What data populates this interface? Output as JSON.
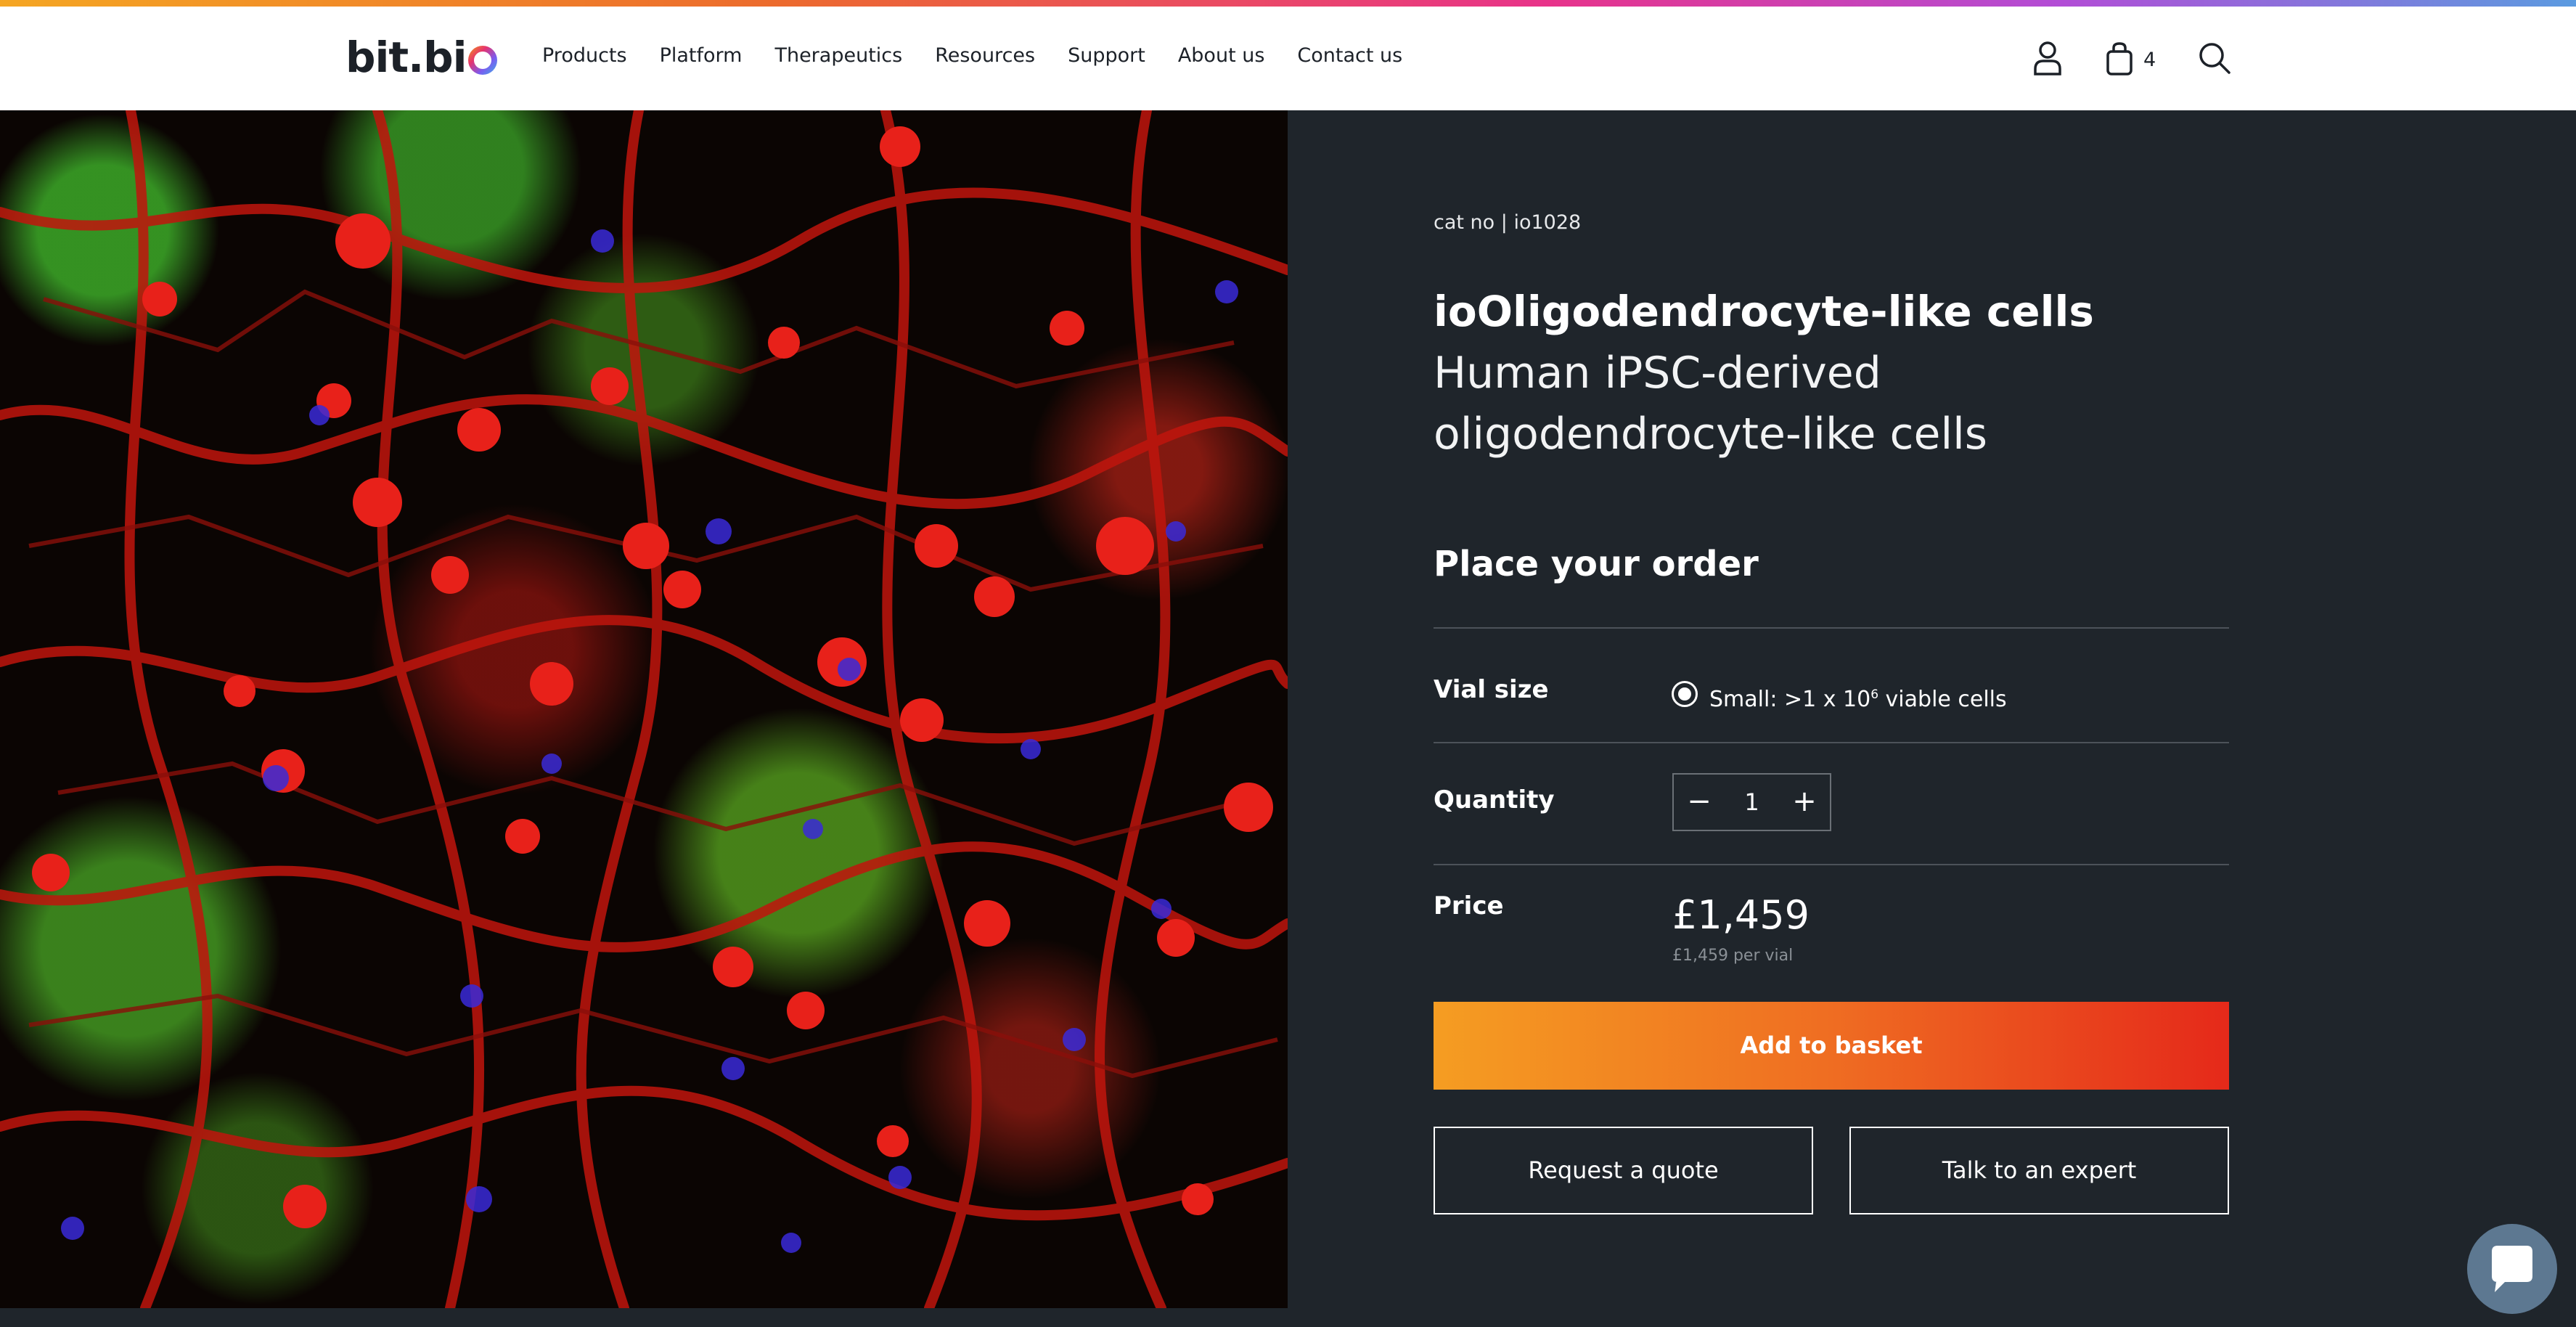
{
  "header": {
    "logo_text": "bit.bi",
    "nav": [
      "Products",
      "Platform",
      "Therapeutics",
      "Resources",
      "Support",
      "About us",
      "Contact us"
    ],
    "cart_count": "4"
  },
  "product": {
    "cat_no": "cat no | io1028",
    "title": "ioOligodendrocyte-like cells",
    "subtitle": "Human iPSC-derived oligodendrocyte-like cells"
  },
  "order": {
    "heading": "Place your order",
    "vial_label": "Vial size",
    "vial_option_pre": "Small: >1 x 10",
    "vial_option_sup": "6",
    "vial_option_post": " viable cells",
    "quantity_label": "Quantity",
    "quantity_value": "1",
    "minus": "−",
    "plus": "+",
    "price_label": "Price",
    "price": "£1,459",
    "price_per": "£1,459 per vial",
    "add_to_basket": "Add to basket",
    "request_quote": "Request a quote",
    "talk_expert": "Talk to an expert"
  },
  "colors": {
    "accent_orange": "#f59d22",
    "accent_red": "#e5291a",
    "background_dark": "#1f252b"
  },
  "icons": [
    "account-icon",
    "basket-icon",
    "search-icon",
    "chat-icon"
  ]
}
